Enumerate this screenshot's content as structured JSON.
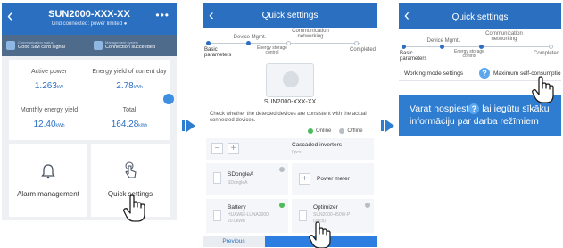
{
  "colors": {
    "header_blue": "#2b6fc0",
    "status_strip": "#4f6b8c",
    "value_blue": "#2c6fc2",
    "online_green": "#4cbc5a",
    "offline_gray": "#b8bec6",
    "callout_blue": "#2f7dd1",
    "arrow_blue": "#2f7dd1"
  },
  "panel1": {
    "title": "SUN2000-XXX-XX",
    "subtitle": "Grid connected: power limited ●",
    "menu_icon": "more-dots-icon",
    "status": [
      {
        "label": "Communication status",
        "value": "Good SIM card signal",
        "icon": "sim-card-icon"
      },
      {
        "label": "Management system",
        "value": "Connection succeeded",
        "icon": "cloud-icon"
      }
    ],
    "metrics": [
      {
        "label": "Active power",
        "value": "1.263",
        "unit": "kW"
      },
      {
        "label": "Energy yield of current day",
        "value": "2.78",
        "unit": "kWh"
      },
      {
        "label": "Monthly energy yield",
        "value": "12.40",
        "unit": "kWh"
      },
      {
        "label": "Total",
        "value": "164.28",
        "unit": "kWh"
      }
    ],
    "tiles": [
      {
        "label": "Alarm management",
        "icon": "alarm-bell-icon"
      },
      {
        "label": "Quick settings",
        "icon": "tap-finger-icon"
      }
    ]
  },
  "panel2": {
    "title": "Quick settings",
    "steps": [
      "Device Mgmt.",
      "Communication networking",
      "Basic parameters",
      "Energy storage control",
      "Completed"
    ],
    "device_name": "SUN2000-XXX-XX",
    "device_check_text": "Check whether the detected devices are consistent with the actual connected devices.",
    "legend": {
      "online": "Online",
      "offline": "Offline"
    },
    "cascaded": {
      "label": "Cascaded inverters",
      "count": "0pcs"
    },
    "devices": [
      {
        "name": "SDongleA",
        "model": "SDongleA",
        "status": "offline",
        "icon": "dongle-icon"
      },
      {
        "name": "Power meter",
        "model": "",
        "status": "",
        "icon": "plus-icon"
      },
      {
        "name": "Battery",
        "model": "HUAWEI-LUNA2000",
        "extra": "20.0kWh",
        "status": "online",
        "icon": "battery-icon"
      },
      {
        "name": "Optimizer",
        "model": "SUN2000-450W-P",
        "extra": "(0pcs)",
        "status": "offline",
        "icon": "optimizer-icon"
      }
    ],
    "footer_previous": "Previous"
  },
  "panel3": {
    "title": "Quick settings",
    "steps": [
      "Device Mgmt.",
      "Communication networking",
      "Basic parameters",
      "Energy storage control",
      "Completed"
    ],
    "working_mode_label": "Working mode settings",
    "working_mode_value": "Maximum self-consumptio",
    "callout_before": "Varat nospiest",
    "callout_after": " lai iegūtu sīkāku informāciju par darba režīmiem"
  }
}
